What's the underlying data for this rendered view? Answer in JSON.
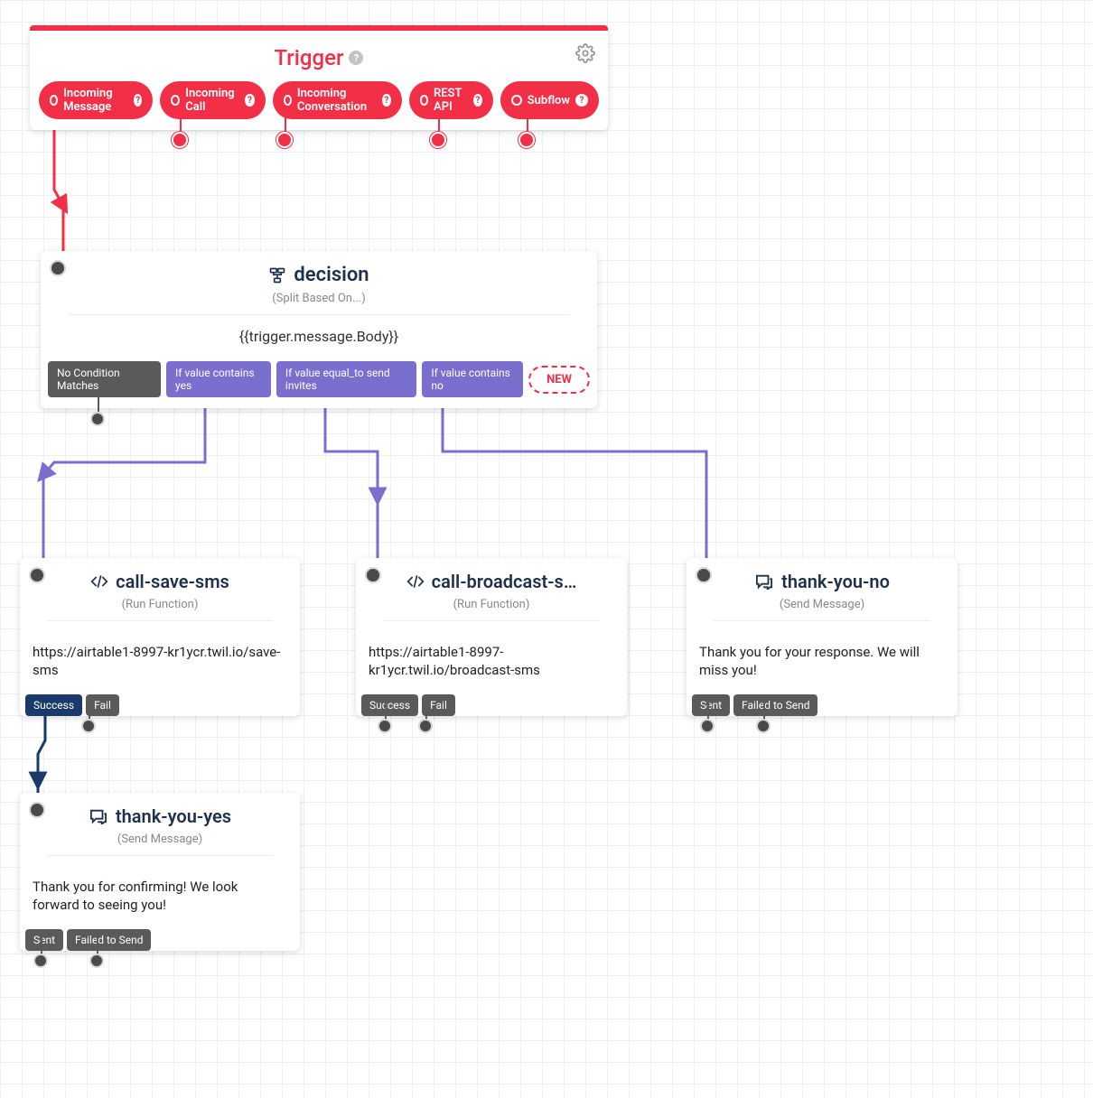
{
  "trigger": {
    "title": "Trigger",
    "pills": [
      "Incoming Message",
      "Incoming Call",
      "Incoming Conversation",
      "REST API",
      "Subflow"
    ]
  },
  "decision": {
    "title": "decision",
    "subtitle": "(Split Based On...)",
    "body": "{{trigger.message.Body}}",
    "chips": {
      "noMatch": "No Condition Matches",
      "yes": "If value contains yes",
      "send": "If value equal_to send invites",
      "no": "If value contains no",
      "new": "NEW"
    }
  },
  "callSave": {
    "title": "call-save-sms",
    "subtitle": "(Run Function)",
    "body": "https://airtable1-8997-kr1ycr.twil.io/save-sms",
    "out": {
      "success": "Success",
      "fail": "Fail"
    }
  },
  "callBroadcast": {
    "title": "call-broadcast-s…",
    "subtitle": "(Run Function)",
    "body": "https://airtable1-8997-kr1ycr.twil.io/broadcast-sms",
    "out": {
      "success": "Success",
      "fail": "Fail"
    }
  },
  "thankNo": {
    "title": "thank-you-no",
    "subtitle": "(Send Message)",
    "body": "Thank you for your response. We will miss you!",
    "out": {
      "sent": "Sent",
      "failed": "Failed to Send"
    }
  },
  "thankYes": {
    "title": "thank-you-yes",
    "subtitle": "(Send Message)",
    "body": "Thank you for confirming! We look forward to seeing you!",
    "out": {
      "sent": "Sent",
      "failed": "Failed to Send"
    }
  }
}
